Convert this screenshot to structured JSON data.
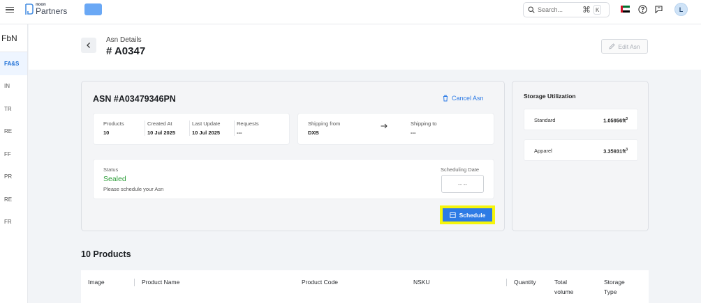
{
  "topbar": {
    "logo_small": "noon",
    "logo_big": "Partners",
    "search_placeholder": "Search...",
    "shortcut_cmd": "⌘",
    "shortcut_key": "K",
    "avatar_initial": "L"
  },
  "sidebar": {
    "title": "FbN",
    "items": [
      {
        "label": "FA&S",
        "active": true
      },
      {
        "label": "IN"
      },
      {
        "label": "TR"
      },
      {
        "label": "RE"
      },
      {
        "label": "FF"
      },
      {
        "label": "PR"
      },
      {
        "label": "RE"
      },
      {
        "label": "FR"
      }
    ]
  },
  "header": {
    "caption": "Asn Details",
    "title": "# A0347",
    "edit_label": "Edit Asn"
  },
  "asn": {
    "number": "ASN #A03479346PN",
    "cancel_label": "Cancel Asn",
    "info": {
      "products_label": "Products",
      "products_value": "10",
      "created_label": "Created At",
      "created_value": "10 Jul 2025",
      "updated_label": "Last Update",
      "updated_value": "10 Jul 2025",
      "requests_label": "Requests",
      "requests_value": "---",
      "from_label": "Shipping from",
      "from_value": "DXB",
      "to_label": "Shipping to",
      "to_value": "---"
    },
    "status": {
      "label": "Status",
      "value": "Sealed",
      "note": "Please schedule your Asn",
      "scheduling_label": "Scheduling Date",
      "scheduling_value": "-- --"
    },
    "schedule_label": "Schedule"
  },
  "storage": {
    "title": "Storage Utilization",
    "rows": [
      {
        "name": "Standard",
        "value": "1.05956ft",
        "unit_sup": "3"
      },
      {
        "name": "Apparel",
        "value": "3.35931ft",
        "unit_sup": "3"
      }
    ]
  },
  "products": {
    "title": "10 Products",
    "columns": [
      "Image",
      "Product Name",
      "Product Code",
      "NSKU",
      "Quantity",
      "Total volume",
      "Storage Type"
    ]
  },
  "colors": {
    "accent": "#2d7be5",
    "status_green": "#2e9e3a",
    "highlight": "#f5f50b"
  }
}
